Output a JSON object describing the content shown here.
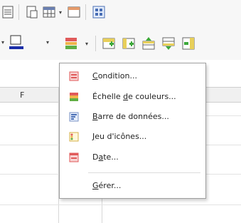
{
  "toolbar": {
    "row1": [
      "sheet-icon",
      "print-preview-icon",
      "table-icon",
      "window-icon",
      "grid-icon"
    ],
    "row2": [
      "border-color-icon",
      "conditional-format-icon",
      "insert-rows-icon",
      "insert-cols-icon",
      "insert-above-icon",
      "insert-below-icon",
      "insert-col-icon"
    ],
    "accent_colors": {
      "border_color": "#1a2ea8",
      "cf_red": "#e05a5a",
      "cf_green": "#5fae44"
    }
  },
  "sheet": {
    "column_header": "F"
  },
  "menu": {
    "items": [
      {
        "label_prefix": "",
        "label_underlined": "C",
        "label_suffix": "ondition...",
        "icon": "condition-icon"
      },
      {
        "label_prefix": "Échelle ",
        "label_underlined": "d",
        "label_suffix": "e couleurs...",
        "icon": "color-scale-icon"
      },
      {
        "label_prefix": "",
        "label_underlined": "B",
        "label_suffix": "arre de données...",
        "icon": "data-bar-icon"
      },
      {
        "label_prefix": "",
        "label_underlined": "J",
        "label_suffix": "eu d'icônes...",
        "icon": "icon-set-icon"
      },
      {
        "label_prefix": "D",
        "label_underlined": "a",
        "label_suffix": "te...",
        "icon": "date-icon"
      }
    ],
    "manage": {
      "label_prefix": "",
      "label_underlined": "G",
      "label_suffix": "érer..."
    }
  }
}
